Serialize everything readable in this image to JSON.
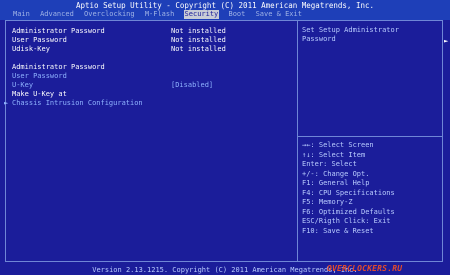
{
  "header": {
    "title": "Aptio Setup Utility - Copyright (C) 2011 American Megatrends, Inc.",
    "tabs": [
      {
        "label": "Main"
      },
      {
        "label": "Advanced"
      },
      {
        "label": "Overclocking"
      },
      {
        "label": "M-Flash"
      },
      {
        "label": "Security"
      },
      {
        "label": "Boot"
      },
      {
        "label": "Save & Exit"
      }
    ],
    "active_tab": "Security"
  },
  "status_rows": [
    {
      "label": "Administrator Password",
      "value": "Not installed"
    },
    {
      "label": "User Password",
      "value": "Not installed"
    },
    {
      "label": "Udisk-Key",
      "value": "Not installed"
    }
  ],
  "settings": {
    "admin_password": "Administrator Password",
    "user_password": "User Password",
    "ukey_label": "U-Key",
    "ukey_value": "[Disabled]",
    "make_ukey": "Make U-Key at",
    "chassis": "Chassis Intrusion Configuration"
  },
  "help_text": "Set Setup Administrator\nPassword",
  "key_help": [
    "→←: Select Screen",
    "↑↓: Select Item",
    "Enter: Select",
    "+/-: Change Opt.",
    "F1: General Help",
    "F4: CPU Specifications",
    "F5: Memory-Z",
    "F6: Optimized Defaults",
    "ESC/Rigth Click: Exit",
    "F10: Save & Reset"
  ],
  "footer": "Version 2.13.1215. Copyright (C) 2011 American Megatrends, Inc.",
  "watermark": "OVERCLOCKERS.RU",
  "colors": {
    "background": "#1b1d9a",
    "header_bar": "#1e3fb8",
    "active_tab_bg": "#c8ccd6",
    "frame": "#6f86d6",
    "link_text": "#8fb3ff"
  }
}
